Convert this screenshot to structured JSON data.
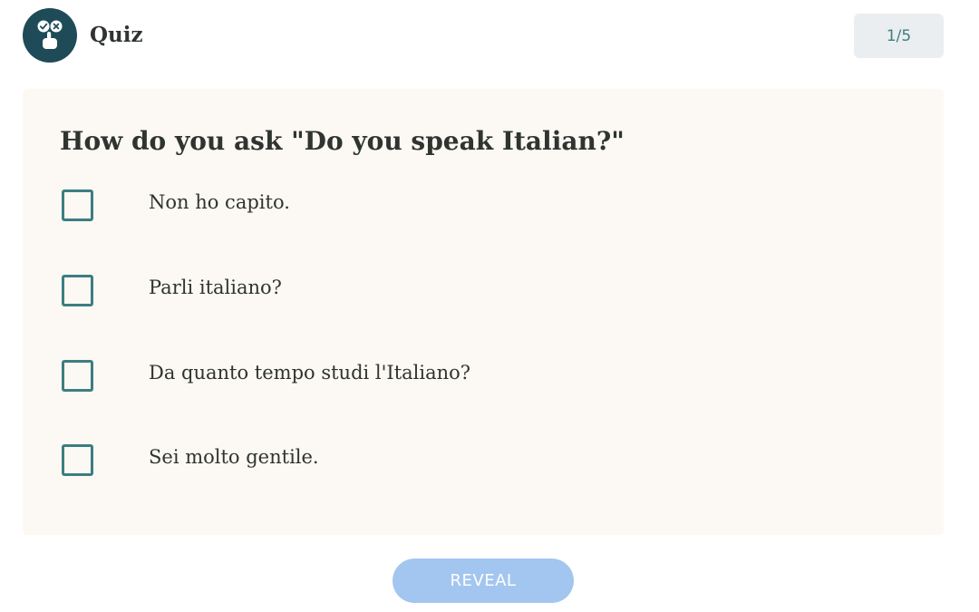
{
  "header": {
    "title": "Quiz",
    "logo_icon": "quiz-hand-check-cross-icon",
    "progress": "1/5"
  },
  "question": {
    "text": "How do you ask \"Do you speak Italian?\"",
    "options": [
      {
        "label": "Non ho capito.",
        "checked": false
      },
      {
        "label": "Parli italiano?",
        "checked": false
      },
      {
        "label": "Da quanto tempo studi l'Italiano?",
        "checked": false
      },
      {
        "label": "Sei molto gentile.",
        "checked": false
      }
    ]
  },
  "actions": {
    "reveal_label": "REVEAL"
  },
  "colors": {
    "accent": "#3c7e82",
    "logo_bg": "#1e4b57",
    "card_bg": "#fcf8f3",
    "badge_bg": "#eaeef0",
    "button_bg": "#a3c6f0"
  }
}
